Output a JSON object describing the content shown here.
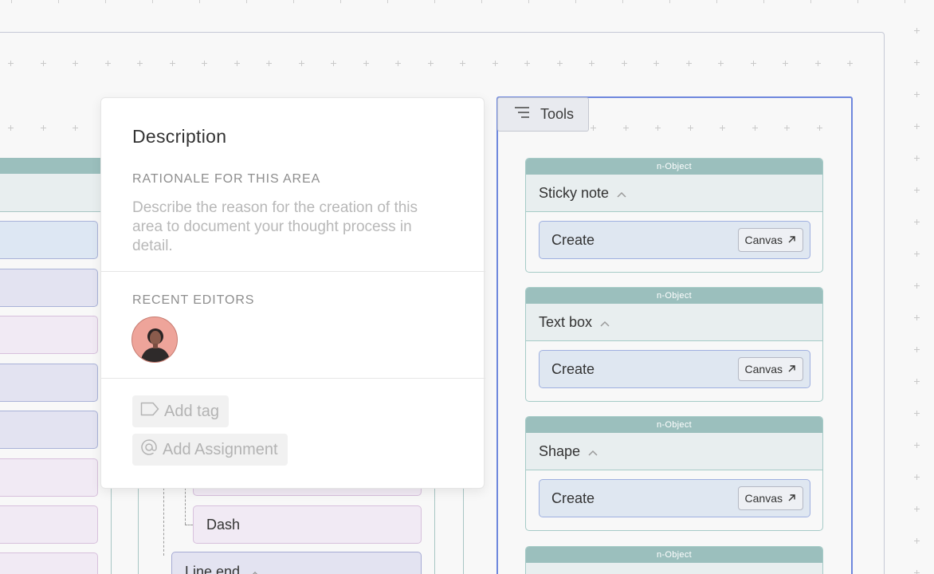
{
  "description_card": {
    "title": "Description",
    "rationale_label": "RATIONALE FOR THIS AREA",
    "rationale_placeholder": "Describe the reason for the creation of this area to document your thought process in detail.",
    "recent_editors_label": "RECENT EDITORS",
    "add_tag_label": "Add tag",
    "add_assignment_label": "Add Assignment"
  },
  "tools_panel": {
    "tab_label": "Tools",
    "objects": [
      {
        "badge": "n-Object",
        "title": "Sticky note",
        "create_label": "Create",
        "canvas_label": "Canvas"
      },
      {
        "badge": "n-Object",
        "title": "Text box",
        "create_label": "Create",
        "canvas_label": "Canvas"
      },
      {
        "badge": "n-Object",
        "title": "Shape",
        "create_label": "Create",
        "canvas_label": "Canvas"
      },
      {
        "badge": "n-Object"
      }
    ]
  },
  "background_nodes": {
    "dash_label": "Dash",
    "line_end_label": "Line end"
  },
  "colors": {
    "accent_blue": "#6e87dd",
    "teal_header": "#9bbfbd",
    "avatar_bg": "#eea49a"
  },
  "icons": {
    "tools": "list-filter-icon",
    "collapse": "chevron-up-icon",
    "open_canvas": "arrow-up-right-icon",
    "tag": "tag-icon",
    "assignment": "at-sign-icon"
  }
}
